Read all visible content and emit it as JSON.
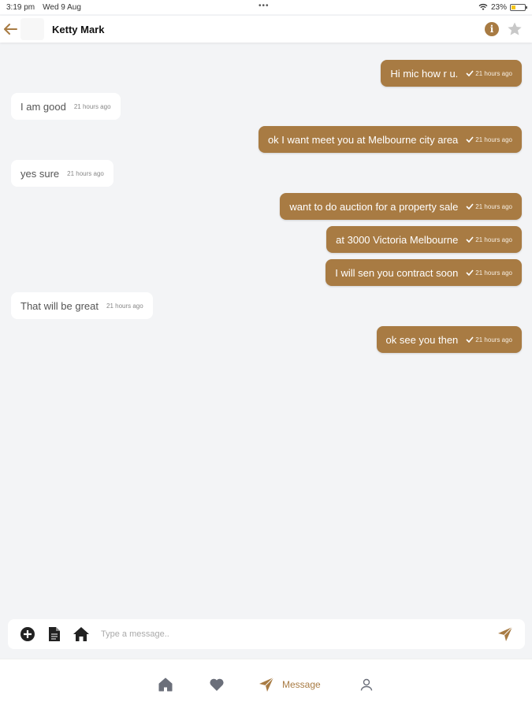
{
  "status_bar": {
    "time": "3:19 pm",
    "date": "Wed 9 Aug",
    "battery": "23%",
    "dots": "•••"
  },
  "header": {
    "contact_name": "Ketty Mark",
    "info_label": "i"
  },
  "colors": {
    "accent": "#a87b43",
    "background": "#f3f4f6",
    "incoming_bg": "#ffffff"
  },
  "messages": [
    {
      "direction": "out",
      "text": "Hi mic how r u.",
      "time": "21 hours ago"
    },
    {
      "direction": "in",
      "text": "I am good",
      "time": "21 hours ago"
    },
    {
      "direction": "out",
      "text": "ok I want meet you at Melbourne city area",
      "time": "21 hours ago"
    },
    {
      "direction": "in",
      "text": "yes sure",
      "time": "21 hours ago"
    },
    {
      "direction": "out",
      "text": "want to do auction for a property sale",
      "time": "21 hours ago"
    },
    {
      "direction": "out",
      "text": "at 3000 Victoria Melbourne",
      "time": "21 hours ago"
    },
    {
      "direction": "out",
      "text": "I will sen you contract soon",
      "time": "21 hours ago"
    },
    {
      "direction": "in",
      "text": "That will be great",
      "time": "21 hours ago"
    },
    {
      "direction": "out",
      "text": "ok see you then",
      "time": "21 hours ago"
    }
  ],
  "composer": {
    "placeholder": "Type a message..",
    "value": "",
    "icons": [
      "plus-circle-icon",
      "document-icon",
      "home-icon",
      "send-icon"
    ]
  },
  "bottom_nav": {
    "items": [
      {
        "icon": "home-icon",
        "label": ""
      },
      {
        "icon": "heart-icon",
        "label": ""
      },
      {
        "icon": "send-icon",
        "label": "Message",
        "active": true
      },
      {
        "icon": "user-icon",
        "label": ""
      }
    ]
  }
}
